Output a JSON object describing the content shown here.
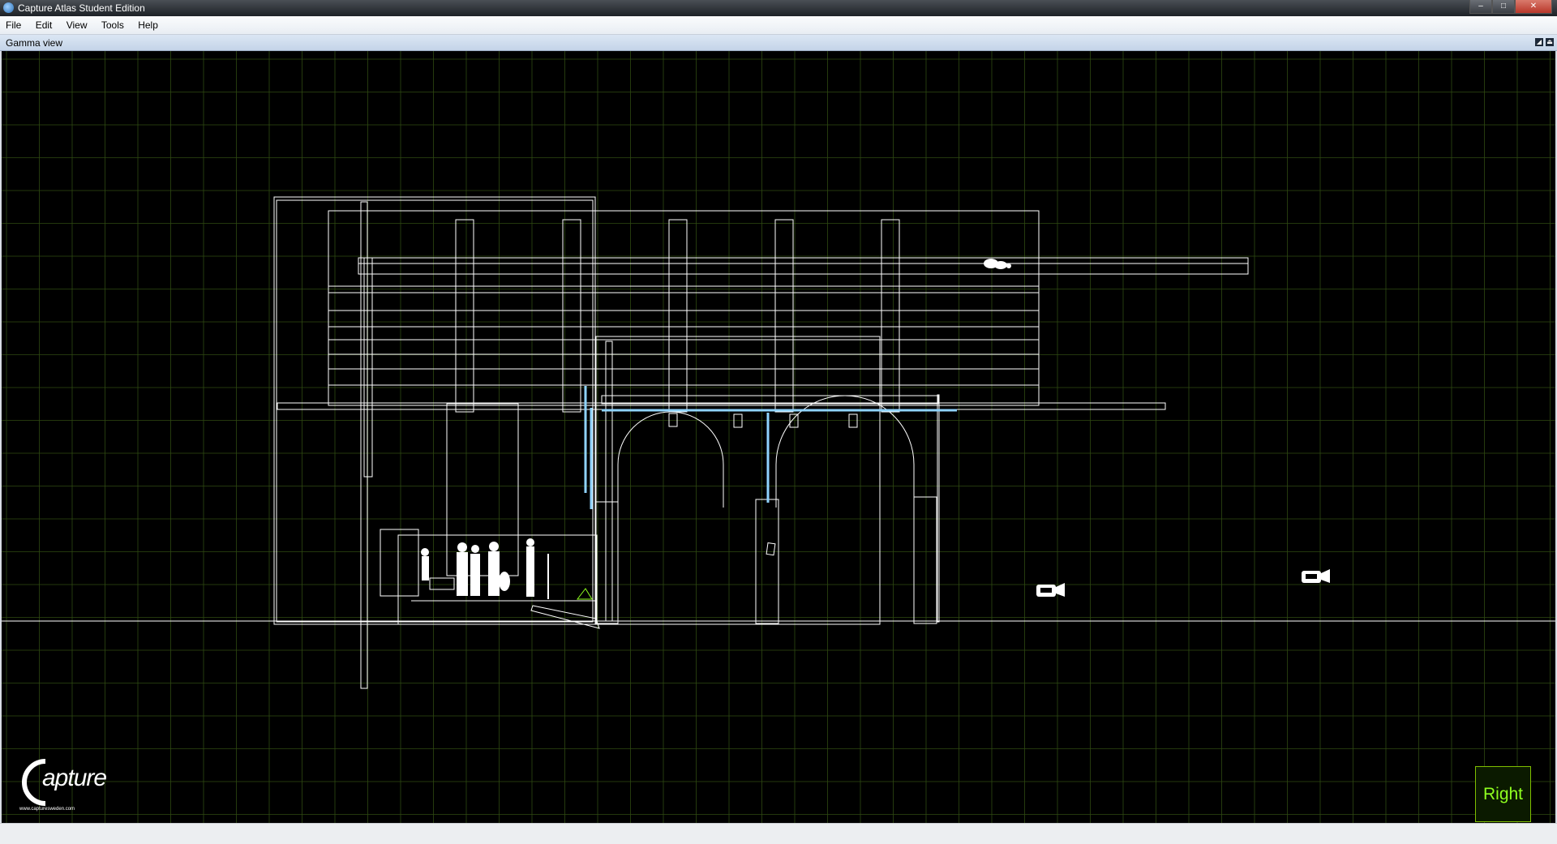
{
  "window": {
    "title": "Capture Atlas Student Edition",
    "min_label": "–",
    "max_label": "□",
    "close_label": "✕"
  },
  "menu": {
    "items": [
      "File",
      "Edit",
      "View",
      "Tools",
      "Help"
    ]
  },
  "view": {
    "title": "Gamma view",
    "label": "Right",
    "icons": [
      "restore-view-icon",
      "eject-view-icon"
    ]
  },
  "logo": {
    "word": "apture",
    "initial": "C",
    "url": "www.capturesweden.com"
  },
  "nav": {
    "icons": [
      "rotate-icon",
      "pan-icon",
      "menu-icon"
    ]
  },
  "colors": {
    "grid": "#2f4a12",
    "wire": "#ffffff",
    "accent_wire": "#8fd3ff",
    "label_green": "#8fff1f",
    "button_border": "#80c820"
  }
}
